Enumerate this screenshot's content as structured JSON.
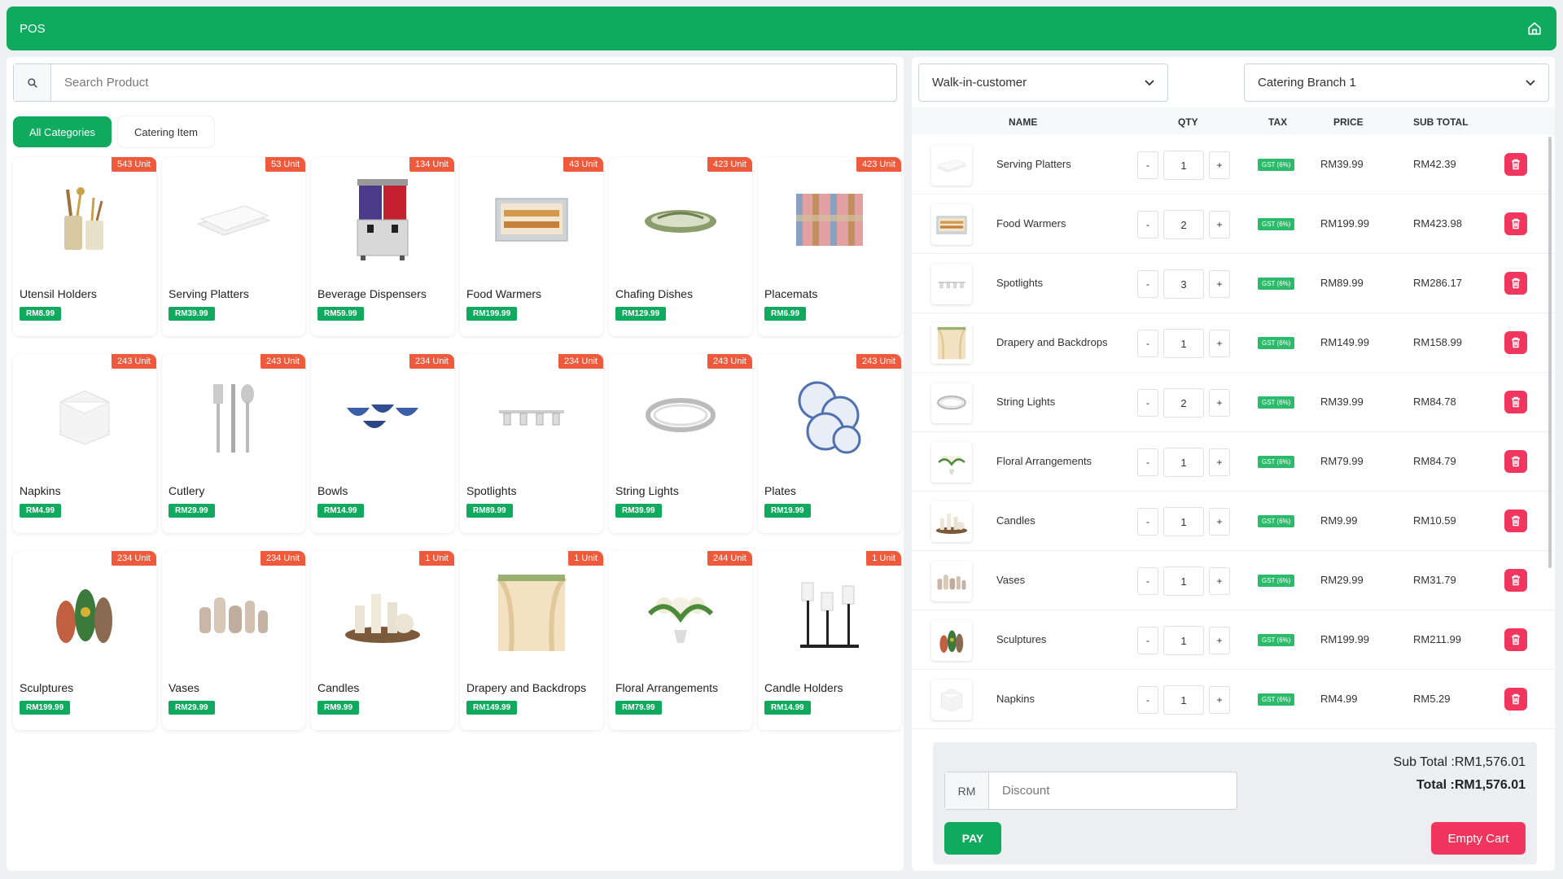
{
  "app": {
    "title": "POS"
  },
  "search": {
    "placeholder": "Search Product"
  },
  "categories": [
    "All Categories",
    "Catering Item"
  ],
  "products": [
    {
      "name": "Utensil Holders",
      "price": "RM8.99",
      "stock": "543 Unit",
      "icon": "utensil-holder"
    },
    {
      "name": "Serving Platters",
      "price": "RM39.99",
      "stock": "53 Unit",
      "icon": "platter"
    },
    {
      "name": "Beverage Dispensers",
      "price": "RM59.99",
      "stock": "134 Unit",
      "icon": "dispenser"
    },
    {
      "name": "Food Warmers",
      "price": "RM199.99",
      "stock": "43 Unit",
      "icon": "warmer"
    },
    {
      "name": "Chafing Dishes",
      "price": "RM129.99",
      "stock": "423 Unit",
      "icon": "chafing"
    },
    {
      "name": "Placemats",
      "price": "RM6.99",
      "stock": "423 Unit",
      "icon": "placemat"
    },
    {
      "name": "Napkins",
      "price": "RM4.99",
      "stock": "243 Unit",
      "icon": "napkin"
    },
    {
      "name": "Cutlery",
      "price": "RM29.99",
      "stock": "243 Unit",
      "icon": "cutlery"
    },
    {
      "name": "Bowls",
      "price": "RM14.99",
      "stock": "234 Unit",
      "icon": "bowls"
    },
    {
      "name": "Spotlights",
      "price": "RM89.99",
      "stock": "234 Unit",
      "icon": "spotlight"
    },
    {
      "name": "String Lights",
      "price": "RM39.99",
      "stock": "243 Unit",
      "icon": "string-lights"
    },
    {
      "name": "Plates",
      "price": "RM19.99",
      "stock": "243 Unit",
      "icon": "plates"
    },
    {
      "name": "Sculptures",
      "price": "RM199.99",
      "stock": "234 Unit",
      "icon": "sculpture"
    },
    {
      "name": "Vases",
      "price": "RM29.99",
      "stock": "234 Unit",
      "icon": "vases"
    },
    {
      "name": "Candles",
      "price": "RM9.99",
      "stock": "1 Unit",
      "icon": "candles"
    },
    {
      "name": "Drapery and Backdrops",
      "price": "RM149.99",
      "stock": "1 Unit",
      "icon": "drapery"
    },
    {
      "name": "Floral Arrangements",
      "price": "RM79.99",
      "stock": "244 Unit",
      "icon": "floral"
    },
    {
      "name": "Candle Holders",
      "price": "RM14.99",
      "stock": "1 Unit",
      "icon": "candle-holders"
    }
  ],
  "customer": {
    "value": "Walk-in-customer"
  },
  "branch": {
    "value": "Catering Branch 1"
  },
  "cart": {
    "headers": {
      "name": "NAME",
      "qty": "QTY",
      "tax": "TAX",
      "price": "PRICE",
      "subtotal": "SUB TOTAL"
    },
    "minus_label": "-",
    "plus_label": "+",
    "items": [
      {
        "name": "Serving Platters",
        "qty": "1",
        "tax": "GST (6%)",
        "price": "RM39.99",
        "subtotal": "RM42.39",
        "icon": "platter"
      },
      {
        "name": "Food Warmers",
        "qty": "2",
        "tax": "GST (6%)",
        "price": "RM199.99",
        "subtotal": "RM423.98",
        "icon": "warmer"
      },
      {
        "name": "Spotlights",
        "qty": "3",
        "tax": "GST (6%)",
        "price": "RM89.99",
        "subtotal": "RM286.17",
        "icon": "spotlight"
      },
      {
        "name": "Drapery and Backdrops",
        "qty": "1",
        "tax": "GST (6%)",
        "price": "RM149.99",
        "subtotal": "RM158.99",
        "icon": "drapery"
      },
      {
        "name": "String Lights",
        "qty": "2",
        "tax": "GST (6%)",
        "price": "RM39.99",
        "subtotal": "RM84.78",
        "icon": "string-lights"
      },
      {
        "name": "Floral Arrangements",
        "qty": "1",
        "tax": "GST (6%)",
        "price": "RM79.99",
        "subtotal": "RM84.79",
        "icon": "floral"
      },
      {
        "name": "Candles",
        "qty": "1",
        "tax": "GST (6%)",
        "price": "RM9.99",
        "subtotal": "RM10.59",
        "icon": "candles"
      },
      {
        "name": "Vases",
        "qty": "1",
        "tax": "GST (6%)",
        "price": "RM29.99",
        "subtotal": "RM31.79",
        "icon": "vases"
      },
      {
        "name": "Sculptures",
        "qty": "1",
        "tax": "GST (6%)",
        "price": "RM199.99",
        "subtotal": "RM211.99",
        "icon": "sculpture"
      },
      {
        "name": "Napkins",
        "qty": "1",
        "tax": "GST (6%)",
        "price": "RM4.99",
        "subtotal": "RM5.29",
        "icon": "napkin"
      }
    ]
  },
  "summary": {
    "currency": "RM",
    "discount_placeholder": "Discount",
    "subtotal": "Sub Total :RM1,576.01",
    "total": "Total :RM1,576.01",
    "pay_label": "PAY",
    "empty_label": "Empty Cart"
  },
  "colors": {
    "primary": "#0faa5e",
    "danger": "#f0365f",
    "stock_badge": "#f05a3c"
  }
}
